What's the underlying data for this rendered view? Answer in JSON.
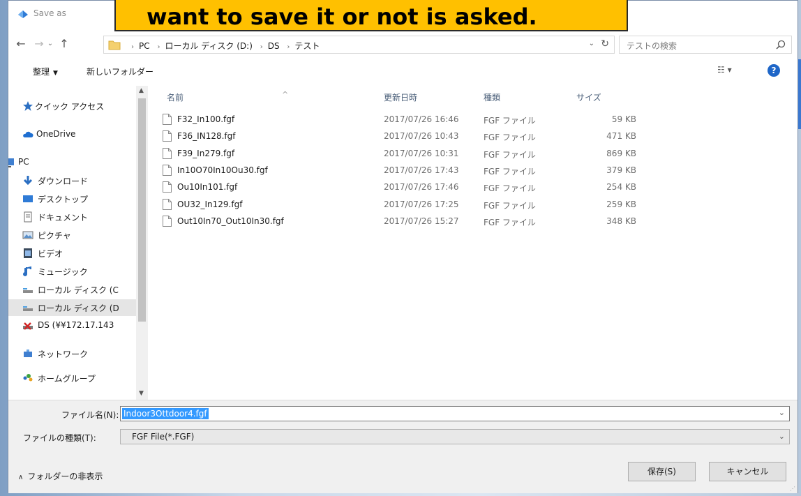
{
  "window": {
    "title": "Save as"
  },
  "callout": {
    "text": "want to save it or not is asked."
  },
  "nav": {
    "back": "←",
    "forward": "→",
    "recent": "⌄",
    "up": "↑"
  },
  "breadcrumb": {
    "items": [
      "PC",
      "ローカル ディスク (D:)",
      "DS",
      "テスト"
    ],
    "dropdown": "⌄",
    "refresh": "↻"
  },
  "search": {
    "placeholder": "テストの検索"
  },
  "toolbar": {
    "organize": "整理",
    "organize_arrow": "▼",
    "new_folder": "新しいフォルダー",
    "view": "☷ ▾",
    "help": "?"
  },
  "sidebar": {
    "items": [
      {
        "label": "クイック アクセス",
        "icon": "star-icon"
      },
      {
        "label": "OneDrive",
        "icon": "cloud-icon"
      },
      {
        "label": "PC",
        "icon": "monitor-icon"
      },
      {
        "label": "ダウンロード",
        "icon": "download-icon"
      },
      {
        "label": "デスクトップ",
        "icon": "desktop-icon"
      },
      {
        "label": "ドキュメント",
        "icon": "document-icon"
      },
      {
        "label": "ピクチャ",
        "icon": "picture-icon"
      },
      {
        "label": "ビデオ",
        "icon": "video-icon"
      },
      {
        "label": "ミュージック",
        "icon": "music-icon"
      },
      {
        "label": "ローカル ディスク (C",
        "icon": "drive-icon"
      },
      {
        "label": "ローカル ディスク (D",
        "icon": "drive-icon"
      },
      {
        "label": "DS (¥¥172.17.143",
        "icon": "network-drive-icon"
      },
      {
        "label": "ネットワーク",
        "icon": "network-icon"
      },
      {
        "label": "ホームグループ",
        "icon": "homegroup-icon"
      }
    ]
  },
  "columns": {
    "name": "名前",
    "date": "更新日時",
    "type": "種類",
    "size": "サイズ"
  },
  "files": [
    {
      "name": "F32_In100.fgf",
      "date": "2017/07/26 16:46",
      "type": "FGF ファイル",
      "size": "59 KB"
    },
    {
      "name": "F36_IN128.fgf",
      "date": "2017/07/26 10:43",
      "type": "FGF ファイル",
      "size": "471 KB"
    },
    {
      "name": "F39_In279.fgf",
      "date": "2017/07/26 10:31",
      "type": "FGF ファイル",
      "size": "869 KB"
    },
    {
      "name": "In10O70In10Ou30.fgf",
      "date": "2017/07/26 17:43",
      "type": "FGF ファイル",
      "size": "379 KB"
    },
    {
      "name": "Ou10In101.fgf",
      "date": "2017/07/26 17:46",
      "type": "FGF ファイル",
      "size": "254 KB"
    },
    {
      "name": "OU32_In129.fgf",
      "date": "2017/07/26 17:25",
      "type": "FGF ファイル",
      "size": "259 KB"
    },
    {
      "name": "Out10In70_Out10In30.fgf",
      "date": "2017/07/26 15:27",
      "type": "FGF ファイル",
      "size": "348 KB"
    }
  ],
  "filename": {
    "label": "ファイル名(N):",
    "value": "Indoor3Ottdoor4.fgf"
  },
  "filetype": {
    "label": "ファイルの種類(T):",
    "value": "FGF File(*.FGF)"
  },
  "footer": {
    "hide_folders": "フォルダーの非表示",
    "save": "保存(S)",
    "cancel": "キャンセル"
  },
  "colors": {
    "accent": "#1e66c8",
    "callout": "#ffc000",
    "selection": "#3399ff"
  }
}
